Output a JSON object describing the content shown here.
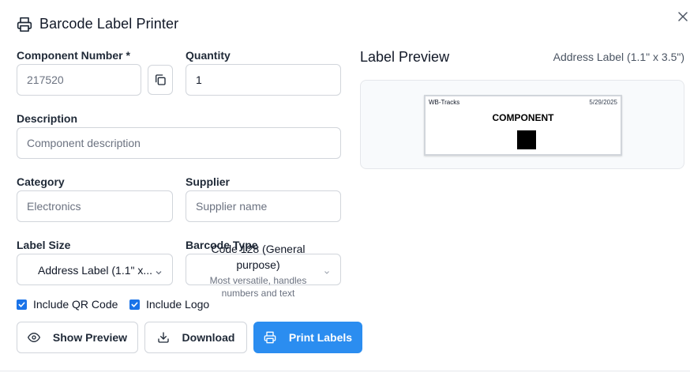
{
  "dialog": {
    "title": "Barcode Label Printer",
    "icons": {
      "header": "printer-icon",
      "close": "close-icon"
    }
  },
  "form": {
    "component_number": {
      "label": "Component Number *",
      "placeholder": "217520",
      "value": ""
    },
    "quantity": {
      "label": "Quantity",
      "value": "1"
    },
    "description": {
      "label": "Description",
      "placeholder": "Component description",
      "value": ""
    },
    "category": {
      "label": "Category",
      "placeholder": "Electronics",
      "value": ""
    },
    "supplier": {
      "label": "Supplier",
      "placeholder": "Supplier name",
      "value": ""
    },
    "label_size": {
      "label": "Label Size",
      "value": "Address Label (1.1\" x..."
    },
    "barcode_type": {
      "label": "Barcode Type",
      "value": "Code 128 (General purpose)",
      "description": "Most versatile, handles numbers and text"
    },
    "include_qr": {
      "label": "Include QR Code",
      "checked": true
    },
    "include_logo": {
      "label": "Include Logo",
      "checked": true
    }
  },
  "actions": {
    "show_preview": "Show Preview",
    "download": "Download",
    "print": "Print Labels"
  },
  "preview": {
    "title": "Label Preview",
    "size": "Address Label (1.1\" x 3.5\")",
    "label": {
      "brand": "WB-Tracks",
      "date": "5/29/2025",
      "text": "COMPONENT"
    }
  },
  "colors": {
    "primary": "#2b8df0",
    "checkbox": "#1a73e8",
    "border": "#d1d5db"
  }
}
